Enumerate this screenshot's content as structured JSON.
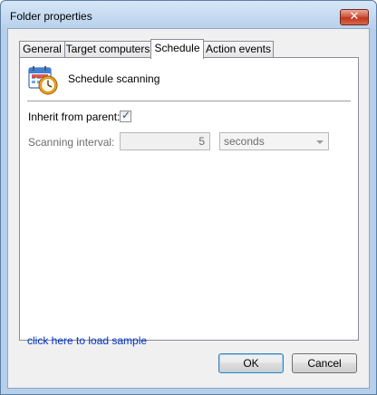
{
  "window": {
    "title": "Folder properties"
  },
  "tabs": [
    {
      "label": "General"
    },
    {
      "label": "Target computers"
    },
    {
      "label": "Schedule"
    },
    {
      "label": "Action events"
    }
  ],
  "schedule": {
    "heading": "Schedule scanning",
    "inherit_label": "Inherit from parent:",
    "inherit_checked": true,
    "interval_label": "Scanning interval:",
    "interval_value": "5",
    "unit_value": "seconds"
  },
  "footer": {
    "sample_link": "click here to load sample",
    "ok_label": "OK",
    "cancel_label": "Cancel"
  },
  "icons": {
    "close": "close-icon",
    "schedule": "schedule-clock-icon",
    "check": "checkmark-icon",
    "dropdown": "chevron-down-icon"
  },
  "colors": {
    "link": "#0033cc",
    "close_button": "#c2361d",
    "title_bar": "#c5dbf2"
  }
}
